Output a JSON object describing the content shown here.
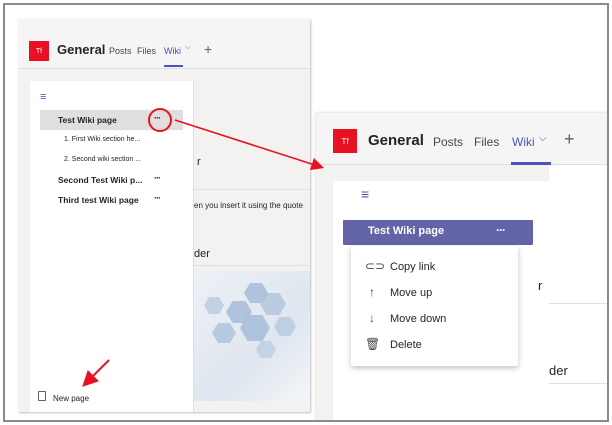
{
  "left": {
    "avatar": "Tf",
    "title": "General",
    "tabs": [
      "Posts",
      "Files",
      "Wiki"
    ],
    "tab_chevron": "⌵",
    "plus": "+",
    "menu_icon": "≡",
    "pages": [
      {
        "label": "Test Wiki page",
        "more": "···"
      },
      {
        "label": "1. First Wiki section he...",
        "more": ""
      },
      {
        "label": "2. Second wiki section ...",
        "more": ""
      },
      {
        "label": "Second Test Wiki p...",
        "more": "···"
      },
      {
        "label": "Third test Wiki page",
        "more": "···"
      }
    ],
    "new_page": "New page",
    "bg_text": {
      "a": "r",
      "b": "en you insert it using the quote",
      "c": "der"
    }
  },
  "right": {
    "avatar": "Tf",
    "title": "General",
    "tabs": [
      "Posts",
      "Files",
      "Wiki"
    ],
    "tab_chevron": "⌵",
    "plus": "+",
    "menu_icon": "≡",
    "selected_page": "Test Wiki page",
    "more": "···",
    "menu": [
      {
        "icon": "link-icon",
        "label": "Copy link"
      },
      {
        "icon": "arrow-up-icon",
        "label": "Move up"
      },
      {
        "icon": "arrow-down-icon",
        "label": "Move down"
      },
      {
        "icon": "trash-icon",
        "label": "Delete"
      }
    ],
    "bg_text": {
      "a": "r",
      "b": "der"
    }
  },
  "colors": {
    "accent": "#4b53bc",
    "selected": "#6264a7",
    "annotation": "#e81123"
  }
}
